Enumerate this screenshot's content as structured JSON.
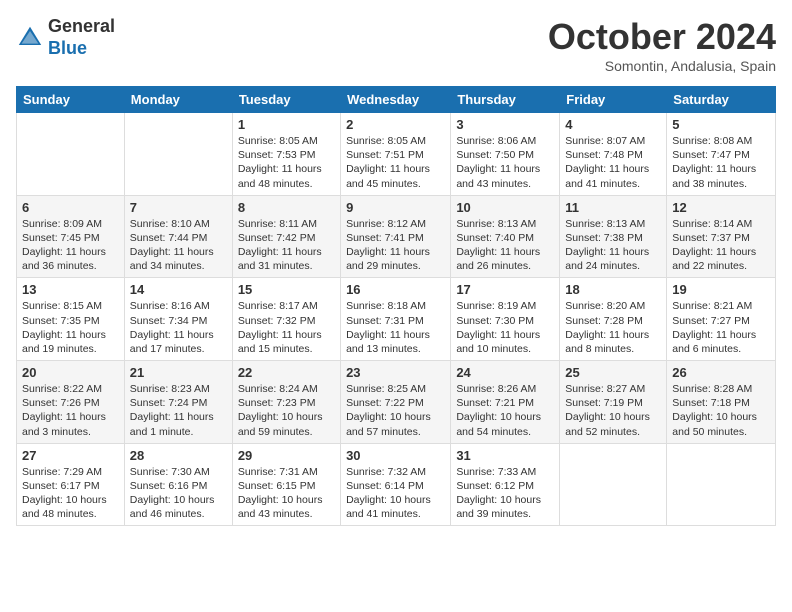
{
  "logo": {
    "general": "General",
    "blue": "Blue"
  },
  "title": "October 2024",
  "location": "Somontin, Andalusia, Spain",
  "days_of_week": [
    "Sunday",
    "Monday",
    "Tuesday",
    "Wednesday",
    "Thursday",
    "Friday",
    "Saturday"
  ],
  "weeks": [
    [
      {
        "day": "",
        "info": ""
      },
      {
        "day": "",
        "info": ""
      },
      {
        "day": "1",
        "info": "Sunrise: 8:05 AM\nSunset: 7:53 PM\nDaylight: 11 hours and 48 minutes."
      },
      {
        "day": "2",
        "info": "Sunrise: 8:05 AM\nSunset: 7:51 PM\nDaylight: 11 hours and 45 minutes."
      },
      {
        "day": "3",
        "info": "Sunrise: 8:06 AM\nSunset: 7:50 PM\nDaylight: 11 hours and 43 minutes."
      },
      {
        "day": "4",
        "info": "Sunrise: 8:07 AM\nSunset: 7:48 PM\nDaylight: 11 hours and 41 minutes."
      },
      {
        "day": "5",
        "info": "Sunrise: 8:08 AM\nSunset: 7:47 PM\nDaylight: 11 hours and 38 minutes."
      }
    ],
    [
      {
        "day": "6",
        "info": "Sunrise: 8:09 AM\nSunset: 7:45 PM\nDaylight: 11 hours and 36 minutes."
      },
      {
        "day": "7",
        "info": "Sunrise: 8:10 AM\nSunset: 7:44 PM\nDaylight: 11 hours and 34 minutes."
      },
      {
        "day": "8",
        "info": "Sunrise: 8:11 AM\nSunset: 7:42 PM\nDaylight: 11 hours and 31 minutes."
      },
      {
        "day": "9",
        "info": "Sunrise: 8:12 AM\nSunset: 7:41 PM\nDaylight: 11 hours and 29 minutes."
      },
      {
        "day": "10",
        "info": "Sunrise: 8:13 AM\nSunset: 7:40 PM\nDaylight: 11 hours and 26 minutes."
      },
      {
        "day": "11",
        "info": "Sunrise: 8:13 AM\nSunset: 7:38 PM\nDaylight: 11 hours and 24 minutes."
      },
      {
        "day": "12",
        "info": "Sunrise: 8:14 AM\nSunset: 7:37 PM\nDaylight: 11 hours and 22 minutes."
      }
    ],
    [
      {
        "day": "13",
        "info": "Sunrise: 8:15 AM\nSunset: 7:35 PM\nDaylight: 11 hours and 19 minutes."
      },
      {
        "day": "14",
        "info": "Sunrise: 8:16 AM\nSunset: 7:34 PM\nDaylight: 11 hours and 17 minutes."
      },
      {
        "day": "15",
        "info": "Sunrise: 8:17 AM\nSunset: 7:32 PM\nDaylight: 11 hours and 15 minutes."
      },
      {
        "day": "16",
        "info": "Sunrise: 8:18 AM\nSunset: 7:31 PM\nDaylight: 11 hours and 13 minutes."
      },
      {
        "day": "17",
        "info": "Sunrise: 8:19 AM\nSunset: 7:30 PM\nDaylight: 11 hours and 10 minutes."
      },
      {
        "day": "18",
        "info": "Sunrise: 8:20 AM\nSunset: 7:28 PM\nDaylight: 11 hours and 8 minutes."
      },
      {
        "day": "19",
        "info": "Sunrise: 8:21 AM\nSunset: 7:27 PM\nDaylight: 11 hours and 6 minutes."
      }
    ],
    [
      {
        "day": "20",
        "info": "Sunrise: 8:22 AM\nSunset: 7:26 PM\nDaylight: 11 hours and 3 minutes."
      },
      {
        "day": "21",
        "info": "Sunrise: 8:23 AM\nSunset: 7:24 PM\nDaylight: 11 hours and 1 minute."
      },
      {
        "day": "22",
        "info": "Sunrise: 8:24 AM\nSunset: 7:23 PM\nDaylight: 10 hours and 59 minutes."
      },
      {
        "day": "23",
        "info": "Sunrise: 8:25 AM\nSunset: 7:22 PM\nDaylight: 10 hours and 57 minutes."
      },
      {
        "day": "24",
        "info": "Sunrise: 8:26 AM\nSunset: 7:21 PM\nDaylight: 10 hours and 54 minutes."
      },
      {
        "day": "25",
        "info": "Sunrise: 8:27 AM\nSunset: 7:19 PM\nDaylight: 10 hours and 52 minutes."
      },
      {
        "day": "26",
        "info": "Sunrise: 8:28 AM\nSunset: 7:18 PM\nDaylight: 10 hours and 50 minutes."
      }
    ],
    [
      {
        "day": "27",
        "info": "Sunrise: 7:29 AM\nSunset: 6:17 PM\nDaylight: 10 hours and 48 minutes."
      },
      {
        "day": "28",
        "info": "Sunrise: 7:30 AM\nSunset: 6:16 PM\nDaylight: 10 hours and 46 minutes."
      },
      {
        "day": "29",
        "info": "Sunrise: 7:31 AM\nSunset: 6:15 PM\nDaylight: 10 hours and 43 minutes."
      },
      {
        "day": "30",
        "info": "Sunrise: 7:32 AM\nSunset: 6:14 PM\nDaylight: 10 hours and 41 minutes."
      },
      {
        "day": "31",
        "info": "Sunrise: 7:33 AM\nSunset: 6:12 PM\nDaylight: 10 hours and 39 minutes."
      },
      {
        "day": "",
        "info": ""
      },
      {
        "day": "",
        "info": ""
      }
    ]
  ]
}
